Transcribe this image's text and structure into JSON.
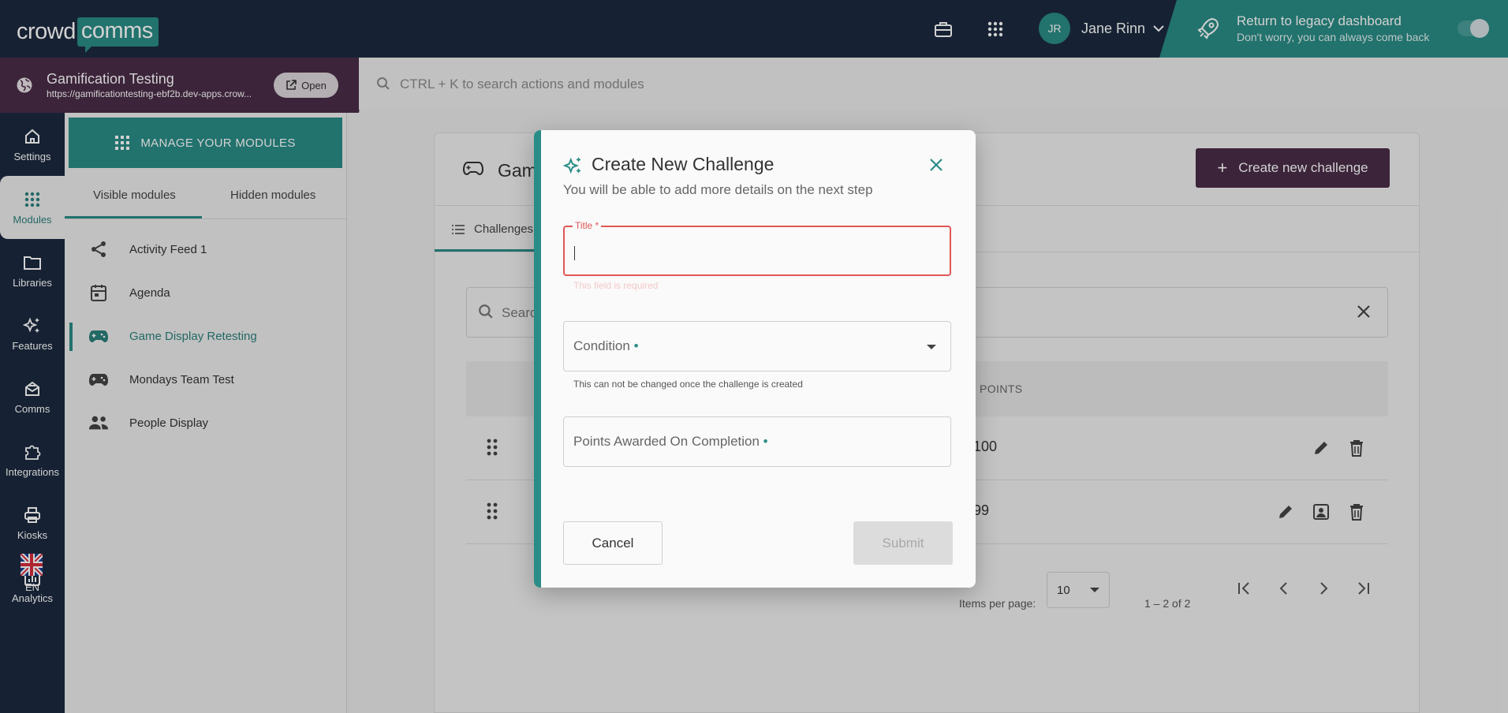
{
  "app": {
    "logo_word": "crowd",
    "logo_badge": "comms"
  },
  "header": {
    "user_initials": "JR",
    "user_name": "Jane Rinn",
    "legacy_title": "Return to legacy dashboard",
    "legacy_sub": "Don't worry, you can always come back",
    "icons": [
      "briefcase-icon",
      "apps-grid-icon",
      "rocket-icon"
    ]
  },
  "project": {
    "name": "Gamification Testing",
    "url": "https://gamificationtesting-ebf2b.dev-apps.crow...",
    "open_label": "Open"
  },
  "global_search": {
    "placeholder": "CTRL + K to search actions and modules"
  },
  "rail": {
    "items": [
      {
        "label": "Settings",
        "icon": "home-icon"
      },
      {
        "label": "Modules",
        "icon": "grid-dots-icon"
      },
      {
        "label": "Libraries",
        "icon": "folder-icon"
      },
      {
        "label": "Features",
        "icon": "sparkles-icon"
      },
      {
        "label": "Comms",
        "icon": "mail-stack-icon"
      },
      {
        "label": "Integrations",
        "icon": "puzzle-icon"
      },
      {
        "label": "Kiosks",
        "icon": "printer-icon"
      },
      {
        "label": "Analytics",
        "icon": "bar-chart-icon"
      }
    ],
    "lang": "EN"
  },
  "modules_panel": {
    "manage_label": "MANAGE YOUR MODULES",
    "tabs": [
      "Visible modules",
      "Hidden modules"
    ],
    "items": [
      {
        "label": "Activity Feed 1",
        "icon": "share-icon"
      },
      {
        "label": "Agenda",
        "icon": "calendar-icon"
      },
      {
        "label": "Game Display Retesting",
        "icon": "gamepad-icon"
      },
      {
        "label": "Mondays Team Test",
        "icon": "gamepad-icon"
      },
      {
        "label": "People Display",
        "icon": "people-icon"
      }
    ]
  },
  "main": {
    "title_partial": "Gam",
    "create_label": "Create new challenge",
    "tab_label": "Challenges",
    "search_placeholder": "Searc",
    "points_header": "POINTS",
    "rows": [
      {
        "points": "100"
      },
      {
        "points": "99"
      }
    ],
    "items_per_page_label": "Items per page:",
    "items_per_page_value": "10",
    "range_label": "1 – 2 of 2"
  },
  "modal": {
    "title": "Create New Challenge",
    "subtitle": "You will be able to add more details on the next step",
    "title_field_label": "Title *",
    "title_field_error": "This field is required",
    "condition_label": "Condition",
    "condition_hint": "This can not be changed once the challenge is created",
    "points_label": "Points Awarded On Completion",
    "required_mark": "•",
    "cancel_label": "Cancel",
    "submit_label": "Submit"
  },
  "colors": {
    "teal": "#2a8c86",
    "navy": "#1c2a3f",
    "plum": "#4a2c47",
    "error": "#e25656"
  }
}
